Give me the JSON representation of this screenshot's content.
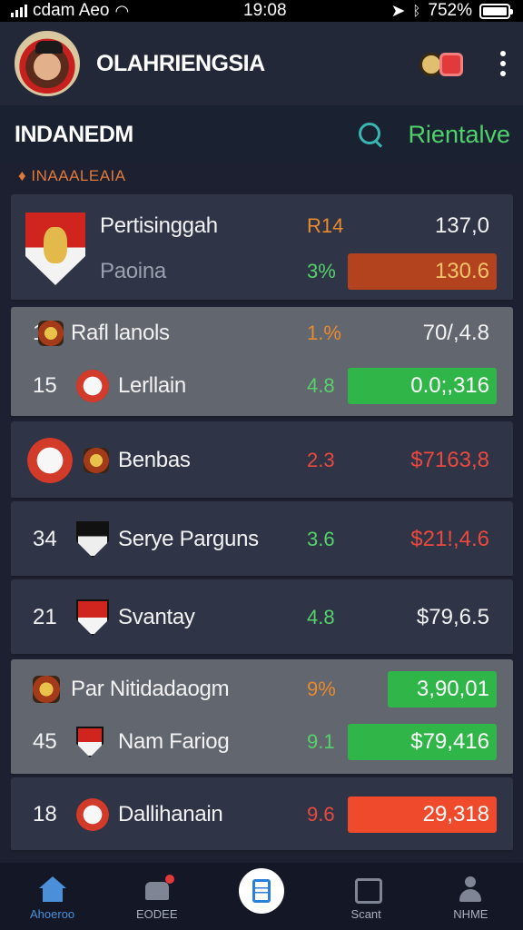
{
  "status": {
    "carrier": "cdam Aeo",
    "time": "19:08",
    "battery": "752%"
  },
  "header": {
    "title": "OLAHRIENGSIA",
    "avatar": "avatar",
    "badge_icon": "badge-icon",
    "menu_icon": "kebab-menu-icon"
  },
  "section": {
    "title": "INDANEDM",
    "search_icon": "search-icon",
    "link": "Rientalve"
  },
  "group_label": "♦ INAAALEAIA",
  "featured": {
    "row1": {
      "name": "Pertisinggah",
      "change": "R14",
      "value": "137,0"
    },
    "row2": {
      "name": "Paoina",
      "change": "3%",
      "value": "130.6"
    }
  },
  "card2": {
    "row1": {
      "rank": "1",
      "name": "Rafl lanols",
      "change": "1.%",
      "value": "70/,4.8"
    },
    "row2": {
      "rank": "15",
      "name": "Lerllain",
      "change": "4.8",
      "value": "0.0;,316"
    }
  },
  "rows": [
    {
      "rank": "",
      "name": "Benbas",
      "change": "2.3",
      "value": "$7163,8"
    },
    {
      "rank": "34",
      "name": "Serye Parguns",
      "change": "3.6",
      "value": "$21!,4.6"
    },
    {
      "rank": "21",
      "name": "Svantay",
      "change": "4.8",
      "value": "$79,6.5"
    }
  ],
  "card6": {
    "row1": {
      "rank": "",
      "name": "Par Nitidadaogm",
      "change": "9%",
      "value": "3,90,01"
    },
    "row2": {
      "rank": "45",
      "name": "Nam Fariog",
      "change": "9.1",
      "value": "$79,416"
    }
  },
  "last": {
    "rank": "18",
    "name": "Dallihanain",
    "change": "9.6",
    "value": "29,318"
  },
  "nav": [
    {
      "label": "Ahoeroo",
      "icon": "home-icon"
    },
    {
      "label": "EODEE",
      "icon": "bell-icon"
    },
    {
      "label": "",
      "icon": "document-icon"
    },
    {
      "label": "Scant",
      "icon": "chat-icon"
    },
    {
      "label": "NHME",
      "icon": "user-icon"
    }
  ],
  "colors": {
    "background": "#1c2030",
    "accent_green": "#2fb548",
    "accent_red": "#ef4a2c",
    "accent_blue": "#4a8fd8",
    "orange": "#e88a2e"
  }
}
